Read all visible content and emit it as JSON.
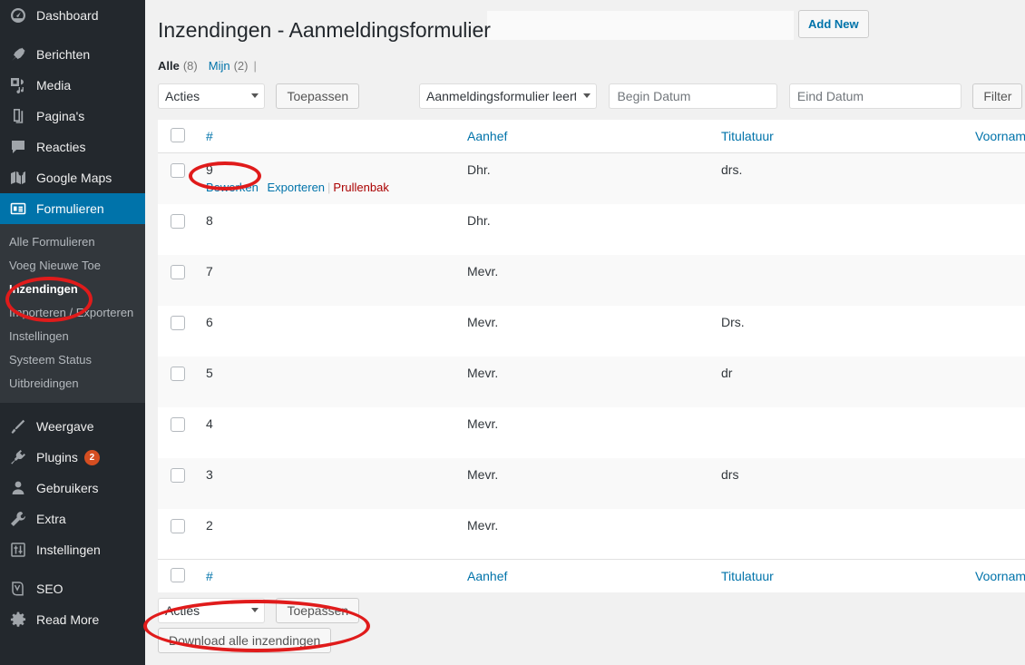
{
  "sidebar": {
    "items": [
      {
        "label": "Dashboard",
        "icon": "dashboard-icon",
        "name": "dashboard"
      },
      {
        "label": "Berichten",
        "icon": "pin-icon",
        "name": "berichten"
      },
      {
        "label": "Media",
        "icon": "media-icon",
        "name": "media"
      },
      {
        "label": "Pagina's",
        "icon": "pages-icon",
        "name": "paginas"
      },
      {
        "label": "Reacties",
        "icon": "comment-icon",
        "name": "reacties"
      },
      {
        "label": "Google Maps",
        "icon": "map-icon",
        "name": "google-maps"
      },
      {
        "label": "Formulieren",
        "icon": "forms-icon",
        "name": "formulieren"
      }
    ],
    "submenu": [
      {
        "label": "Alle Formulieren",
        "name": "alle-formulieren"
      },
      {
        "label": "Voeg Nieuwe Toe",
        "name": "voeg-nieuwe-toe"
      },
      {
        "label": "Inzendingen",
        "name": "inzendingen"
      },
      {
        "label": "Importeren / Exporteren",
        "name": "importeren-exporteren"
      },
      {
        "label": "Instellingen",
        "name": "instellingen"
      },
      {
        "label": "Systeem Status",
        "name": "systeem-status"
      },
      {
        "label": "Uitbreidingen",
        "name": "uitbreidingen"
      }
    ],
    "items2": [
      {
        "label": "Weergave",
        "icon": "appearance-icon",
        "name": "weergave",
        "badge": ""
      },
      {
        "label": "Plugins",
        "icon": "plugins-icon",
        "name": "plugins",
        "badge": "2"
      },
      {
        "label": "Gebruikers",
        "icon": "users-icon",
        "name": "gebruikers",
        "badge": ""
      },
      {
        "label": "Extra",
        "icon": "tools-icon",
        "name": "extra",
        "badge": ""
      },
      {
        "label": "Instellingen",
        "icon": "settings-icon",
        "name": "instellingen-main",
        "badge": ""
      }
    ],
    "items3": [
      {
        "label": "SEO",
        "icon": "yoast-icon",
        "name": "seo"
      },
      {
        "label": "Read More",
        "icon": "gear-icon",
        "name": "read-more"
      }
    ],
    "accent_active": "#0073aa",
    "badge_color": "#d54e21"
  },
  "header": {
    "title": "Inzendingen - Aanmeldingsformulier",
    "add_new_label": "Add New",
    "title_field_value": ""
  },
  "views": {
    "all_label": "Alle",
    "all_count": "(8)",
    "mine_label": "Mijn",
    "mine_count": "(2)",
    "separator": "|"
  },
  "tablenav_top": {
    "bulk_action_selected": "Acties",
    "apply_label": "Toepassen",
    "form_filter_selected": "Aanmeldingsformulier leerth",
    "begin_date_placeholder": "Begin Datum",
    "begin_date_value": "",
    "eind_date_placeholder": "Eind Datum",
    "eind_date_value": "",
    "filter_label": "Filter"
  },
  "tablenav_bottom": {
    "bulk_action_selected": "Acties",
    "apply_label": "Toepassen",
    "download_all_label": "Download alle inzendingen"
  },
  "table": {
    "columns": [
      {
        "key": "cb",
        "label": ""
      },
      {
        "key": "id",
        "label": "#"
      },
      {
        "key": "aanhef",
        "label": "Aanhef"
      },
      {
        "key": "titulatuur",
        "label": "Titulatuur"
      },
      {
        "key": "voornamen",
        "label": "Voornamen"
      }
    ],
    "row_actions": {
      "edit": "Bewerken",
      "export": "Exporteren",
      "trash": "Prullenbak"
    },
    "rows": [
      {
        "id": "9",
        "aanhef": "Dhr.",
        "titulatuur": "drs.",
        "voornamen": "",
        "shaded": true,
        "has_actions": true
      },
      {
        "id": "8",
        "aanhef": "Dhr.",
        "titulatuur": "",
        "voornamen": "",
        "shaded": false,
        "has_actions": false
      },
      {
        "id": "7",
        "aanhef": "Mevr.",
        "titulatuur": "",
        "voornamen": "",
        "shaded": true,
        "has_actions": false
      },
      {
        "id": "6",
        "aanhef": "Mevr.",
        "titulatuur": "Drs.",
        "voornamen": "",
        "shaded": false,
        "has_actions": false
      },
      {
        "id": "5",
        "aanhef": "Mevr.",
        "titulatuur": "dr",
        "voornamen": "",
        "shaded": true,
        "has_actions": false
      },
      {
        "id": "4",
        "aanhef": "Mevr.",
        "titulatuur": "",
        "voornamen": "",
        "shaded": false,
        "has_actions": false
      },
      {
        "id": "3",
        "aanhef": "Mevr.",
        "titulatuur": "drs",
        "voornamen": "",
        "shaded": true,
        "has_actions": false
      },
      {
        "id": "2",
        "aanhef": "Mevr.",
        "titulatuur": "",
        "voornamen": "",
        "shaded": false,
        "has_actions": false
      }
    ]
  },
  "annotations": {
    "color": "#e01b1b",
    "marks": [
      {
        "name": "annotation-inzendingen",
        "target": "Inzendingen"
      },
      {
        "name": "annotation-bewerken",
        "target": "Bewerken"
      },
      {
        "name": "annotation-download-alle-inzendingen",
        "target": "Download alle inzendingen"
      }
    ]
  }
}
